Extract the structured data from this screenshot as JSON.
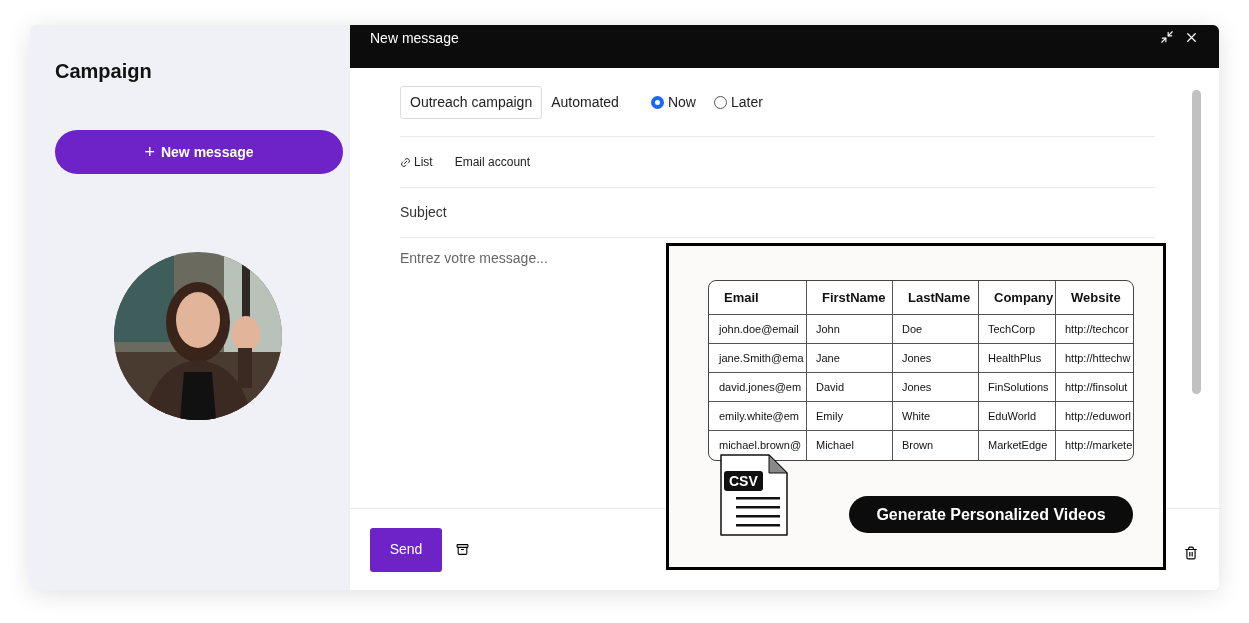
{
  "sidebar": {
    "title": "Campaign",
    "new_button": {
      "icon": "+",
      "label": "New message"
    }
  },
  "composer": {
    "title": "New message",
    "campaign_name": "Outreach campaign",
    "mode_label": "Automated",
    "timing": [
      {
        "label": "Now",
        "selected": true
      },
      {
        "label": "Later",
        "selected": false
      }
    ],
    "links": [
      {
        "label": "List",
        "has_icon": true
      },
      {
        "label": "Email account",
        "has_icon": false
      }
    ],
    "subject_placeholder": "Subject",
    "message_placeholder": "Entrez votre message...",
    "send_label": "Send"
  },
  "overlay": {
    "table": {
      "columns": [
        "Email",
        "FirstName",
        "LastName",
        "Company",
        "Website"
      ],
      "rows": [
        [
          "john.doe@email",
          "John",
          "Doe",
          "TechCorp",
          "http://techcor"
        ],
        [
          "jane.Smith@ema",
          "Jane",
          "Jones",
          "HealthPlus",
          "http://httechw"
        ],
        [
          "david.jones@em",
          "David",
          "Jones",
          "FinSolutions",
          "http://finsolut"
        ],
        [
          "emily.white@em",
          "Emily",
          "White",
          "EduWorld",
          "http://eduworl"
        ],
        [
          "michael.brown@",
          "Michael",
          "Brown",
          "MarketEdge",
          "http://markete"
        ]
      ]
    },
    "file_badge": "CSV",
    "action_label": "Generate Personalized Videos"
  }
}
